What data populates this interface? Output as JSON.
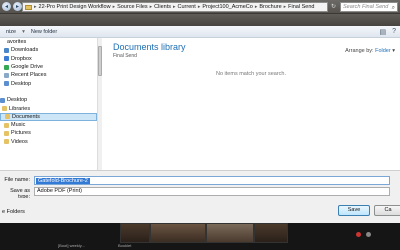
{
  "address_bar": {
    "breadcrumbs": [
      "22-Pro Print Design Workflow",
      "Source Files",
      "Clients",
      "Current",
      "Project100_AcmeCo",
      "Brochure",
      "Final Send"
    ],
    "search_placeholder": "Search Final Send"
  },
  "toolbar": {
    "organize_label": "nize",
    "new_folder_label": "New folder"
  },
  "nav": {
    "items": [
      {
        "label": "avorites",
        "color": "#e5c365"
      },
      {
        "label": "Downloads",
        "color": "#4a86c8"
      },
      {
        "label": "Dropbox",
        "color": "#3a7bd5"
      },
      {
        "label": "Google Drive",
        "color": "#34a853"
      },
      {
        "label": "Recent Places",
        "color": "#8aa8c8"
      },
      {
        "label": "Desktop",
        "color": "#5b8fd0"
      },
      {
        "label": "",
        "color": ""
      },
      {
        "label": "Desktop",
        "color": "#5b8fd0"
      },
      {
        "label": "Libraries",
        "color": "#e5c365"
      },
      {
        "label": "Documents",
        "color": "#e5c365",
        "selected": true
      },
      {
        "label": "Music",
        "color": "#e5c365"
      },
      {
        "label": "Pictures",
        "color": "#e5c365"
      },
      {
        "label": "Videos",
        "color": "#e5c365"
      }
    ]
  },
  "content": {
    "library_title": "Documents library",
    "library_subtitle": "Final Send",
    "arrange_label": "Arrange by:",
    "arrange_value": "Folder",
    "empty_message": "No items match your search."
  },
  "fields": {
    "filename_label": "File name:",
    "filename_value": "Gatefold-Brochure-2",
    "type_label": "Save as type:",
    "type_value": "Adobe PDF (Print)"
  },
  "footer": {
    "hide_folders_label": "e Folders",
    "save_label": "Save",
    "cancel_label": "Ca"
  },
  "taskbar": {
    "labels": [
      "[Boot] weekly...",
      "Booklet"
    ]
  }
}
